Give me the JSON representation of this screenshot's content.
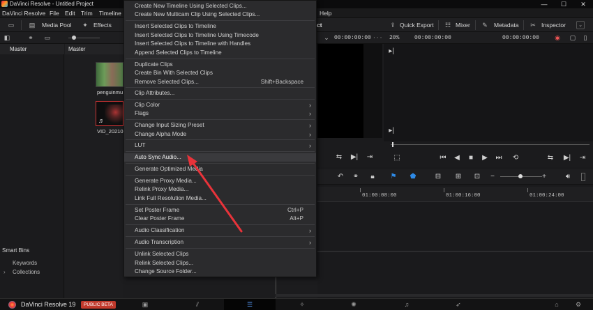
{
  "window": {
    "title": "DaVinci Resolve - Untitled Project",
    "controls": [
      "—",
      "☐",
      "✕"
    ]
  },
  "menubar": {
    "items": [
      "DaVinci Resolve",
      "File",
      "Edit",
      "Trim",
      "Timeline",
      "Help"
    ]
  },
  "toolbar": {
    "media_pool": "Media Pool",
    "effects": "Effects",
    "project_tail": "ct",
    "quick_export": "Quick Export",
    "mixer": "Mixer",
    "metadata": "Metadata",
    "inspector": "Inspector"
  },
  "subbar": {
    "timecode_left": "00:00:00:00",
    "zoom": "20%",
    "timecode_right": "00:00:00:00",
    "timecode_far": "00:00:00:00"
  },
  "left_panel": {
    "master": "Master",
    "smart_bins": "Smart Bins",
    "keywords": "Keywords",
    "collections": "Collections"
  },
  "pool": {
    "header": "Master",
    "clips": [
      {
        "label": "penguinmu"
      },
      {
        "label": "VID_202105"
      }
    ]
  },
  "timeline": {
    "ruler": [
      "01:00:08:00",
      "01:00:16:00",
      "01:00:24:00"
    ]
  },
  "pagebar": {
    "app_name": "DaVinci Resolve 19",
    "badge": "PUBLIC BETA",
    "pages": [
      "media-page-icon",
      "cut-page-icon",
      "edit-page-icon",
      "fusion-page-icon",
      "color-page-icon",
      "fairlight-page-icon",
      "deliver-page-icon"
    ]
  },
  "context_menu": {
    "items": [
      {
        "label": "Create New Timeline Using Selected Clips..."
      },
      {
        "label": "Create New Multicam Clip Using Selected Clips..."
      },
      {
        "label": "Insert Selected Clips to Timeline"
      },
      {
        "label": "Insert Selected Clips to Timeline Using Timecode"
      },
      {
        "label": "Insert Selected Clips to Timeline with Handles"
      },
      {
        "label": "Append Selected Clips to Timeline"
      },
      {
        "label": "Duplicate Clips"
      },
      {
        "label": "Create Bin With Selected Clips"
      },
      {
        "label": "Remove Selected Clips...",
        "shortcut": "Shift+Backspace"
      },
      {
        "label": "Clip Attributes..."
      },
      {
        "label": "Clip Color",
        "submenu": true
      },
      {
        "label": "Flags",
        "submenu": true
      },
      {
        "label": "Change Input Sizing Preset",
        "submenu": true
      },
      {
        "label": "Change Alpha Mode",
        "submenu": true
      },
      {
        "label": "LUT",
        "submenu": true
      },
      {
        "label": "Auto Sync Audio...",
        "highlighted": true
      },
      {
        "label": "Generate Optimized Media"
      },
      {
        "label": "Generate Proxy Media..."
      },
      {
        "label": "Relink Proxy Media..."
      },
      {
        "label": "Link Full Resolution Media..."
      },
      {
        "label": "Set Poster Frame",
        "shortcut": "Ctrl+P"
      },
      {
        "label": "Clear Poster Frame",
        "shortcut": "Alt+P"
      },
      {
        "label": "Audio Classification",
        "submenu": true
      },
      {
        "label": "Audio Transcription",
        "submenu": true
      },
      {
        "label": "Unlink Selected Clips"
      },
      {
        "label": "Relink Selected Clips..."
      },
      {
        "label": "Change Source Folder..."
      }
    ]
  },
  "annotation": {
    "arrow_color": "#e8333a"
  },
  "colors": {
    "accent_blue": "#2e8ae6",
    "badge_red": "#c0392b",
    "highlight": "#3a3a3d"
  }
}
